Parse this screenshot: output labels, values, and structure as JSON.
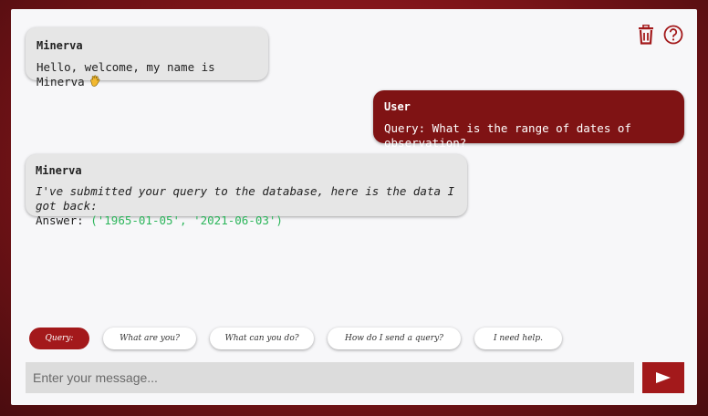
{
  "toolbar": {
    "delete_icon": "trash-icon",
    "help_icon": "help-circle-icon"
  },
  "messages": [
    {
      "sender": "Minerva",
      "text": "Hello, welcome, my name is Minerva",
      "emoji": "waving-hand"
    },
    {
      "sender": "User",
      "text": "Query: What is the range of dates of observation?"
    },
    {
      "sender": "Minerva",
      "text": "I've submitted your query to the database, here is the data I got back:",
      "answer_label": "Answer:",
      "answer_value": "('1965-01-05', '2021-06-03')"
    }
  ],
  "chips": [
    "Query:",
    "What are you?",
    "What can you do?",
    "How do I send a query?",
    "I need help."
  ],
  "input": {
    "placeholder": "Enter your message..."
  },
  "send": {
    "icon": "send-arrow-icon"
  },
  "colors": {
    "accent": "#a3191b",
    "user_bubble": "#7f1314",
    "bot_bubble": "#e6e6e6",
    "answer": "#2bb55a"
  }
}
